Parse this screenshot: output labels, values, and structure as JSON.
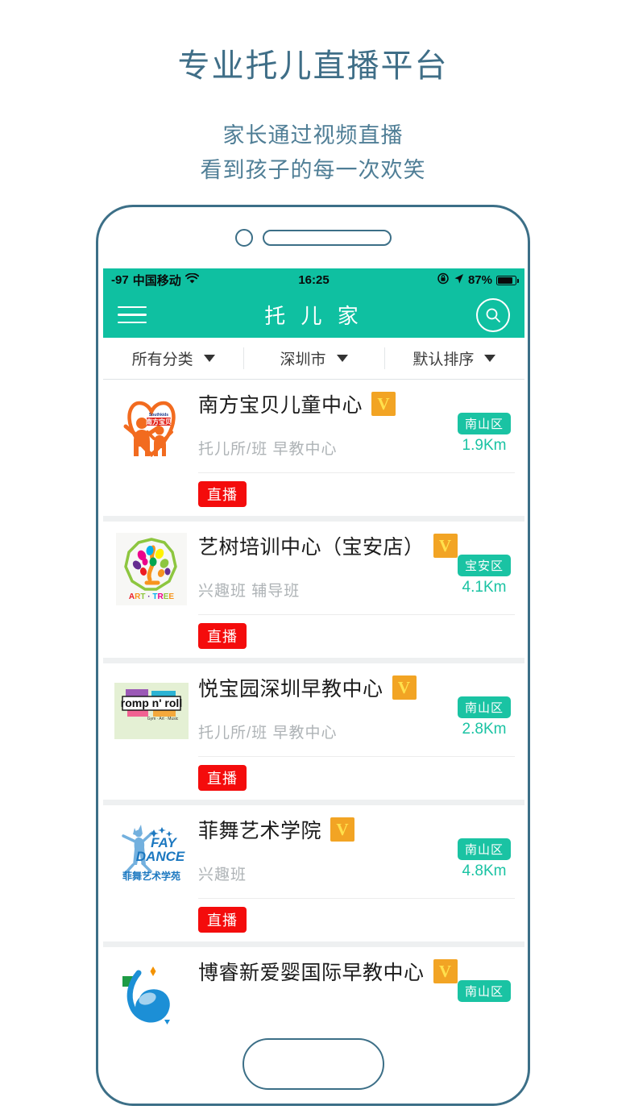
{
  "promo": {
    "title": "专业托儿直播平台",
    "subtitle_line1": "家长通过视频直播",
    "subtitle_line2": "看到孩子的每一次欢笑"
  },
  "status_bar": {
    "signal": "-97",
    "carrier": "中国移动",
    "wifi_icon": "wifi-icon",
    "time": "16:25",
    "rotation_lock_icon": "rotation-lock-icon",
    "location_icon": "location-arrow-icon",
    "battery_percent": "87%",
    "battery_icon": "battery-icon"
  },
  "nav": {
    "menu_icon": "hamburger-menu-icon",
    "title": "托 儿 家",
    "search_icon": "search-icon"
  },
  "filters": [
    {
      "label": "所有分类",
      "icon": "chevron-down-icon"
    },
    {
      "label": "深圳市",
      "icon": "chevron-down-icon"
    },
    {
      "label": "默认排序",
      "icon": "chevron-down-icon"
    }
  ],
  "colors": {
    "brand_teal": "#0FC0A1",
    "badge_teal": "#1AC3A3",
    "verified_orange": "#F2A424",
    "verified_letter": "#FFE14D",
    "live_red": "#F40C0C",
    "frame_blue": "#3C6F87",
    "promo_text": "#3F6E87"
  },
  "listings": [
    {
      "name": "南方宝贝儿童中心",
      "verified_badge": "V",
      "tags": "托儿所/班  早教中心",
      "district": "南山区",
      "distance": "1.9Km",
      "live_label": "直播",
      "logo_name": "southkids-logo",
      "logo_caption": "Southkids 南方宝贝"
    },
    {
      "name": "艺树培训中心（宝安店）",
      "verified_badge": "V",
      "tags": "兴趣班  辅导班",
      "district": "宝安区",
      "distance": "4.1Km",
      "live_label": "直播",
      "logo_name": "art-tree-logo",
      "logo_caption": "ART · TREE"
    },
    {
      "name": "悦宝园深圳早教中心",
      "verified_badge": "V",
      "tags": "托儿所/班  早教中心",
      "district": "南山区",
      "distance": "2.8Km",
      "live_label": "直播",
      "logo_name": "romp-n-roll-logo",
      "logo_caption": "romp n' roll"
    },
    {
      "name": "菲舞艺术学院",
      "verified_badge": "V",
      "tags": "兴趣班",
      "district": "南山区",
      "distance": "4.8Km",
      "live_label": "直播",
      "logo_name": "fay-dance-logo",
      "logo_caption": "FAY DANCE 菲舞艺术学苑"
    },
    {
      "name": "博睿新爱婴国际早教中心",
      "verified_badge": "V",
      "tags": "",
      "district": "南山区",
      "distance": "",
      "live_label": "",
      "logo_name": "borui-aiying-logo",
      "logo_caption": ""
    }
  ],
  "phone_frame": {
    "camera_icon": "front-camera-icon",
    "speaker_icon": "earpiece-speaker-icon",
    "home_button_icon": "home-button-icon"
  }
}
